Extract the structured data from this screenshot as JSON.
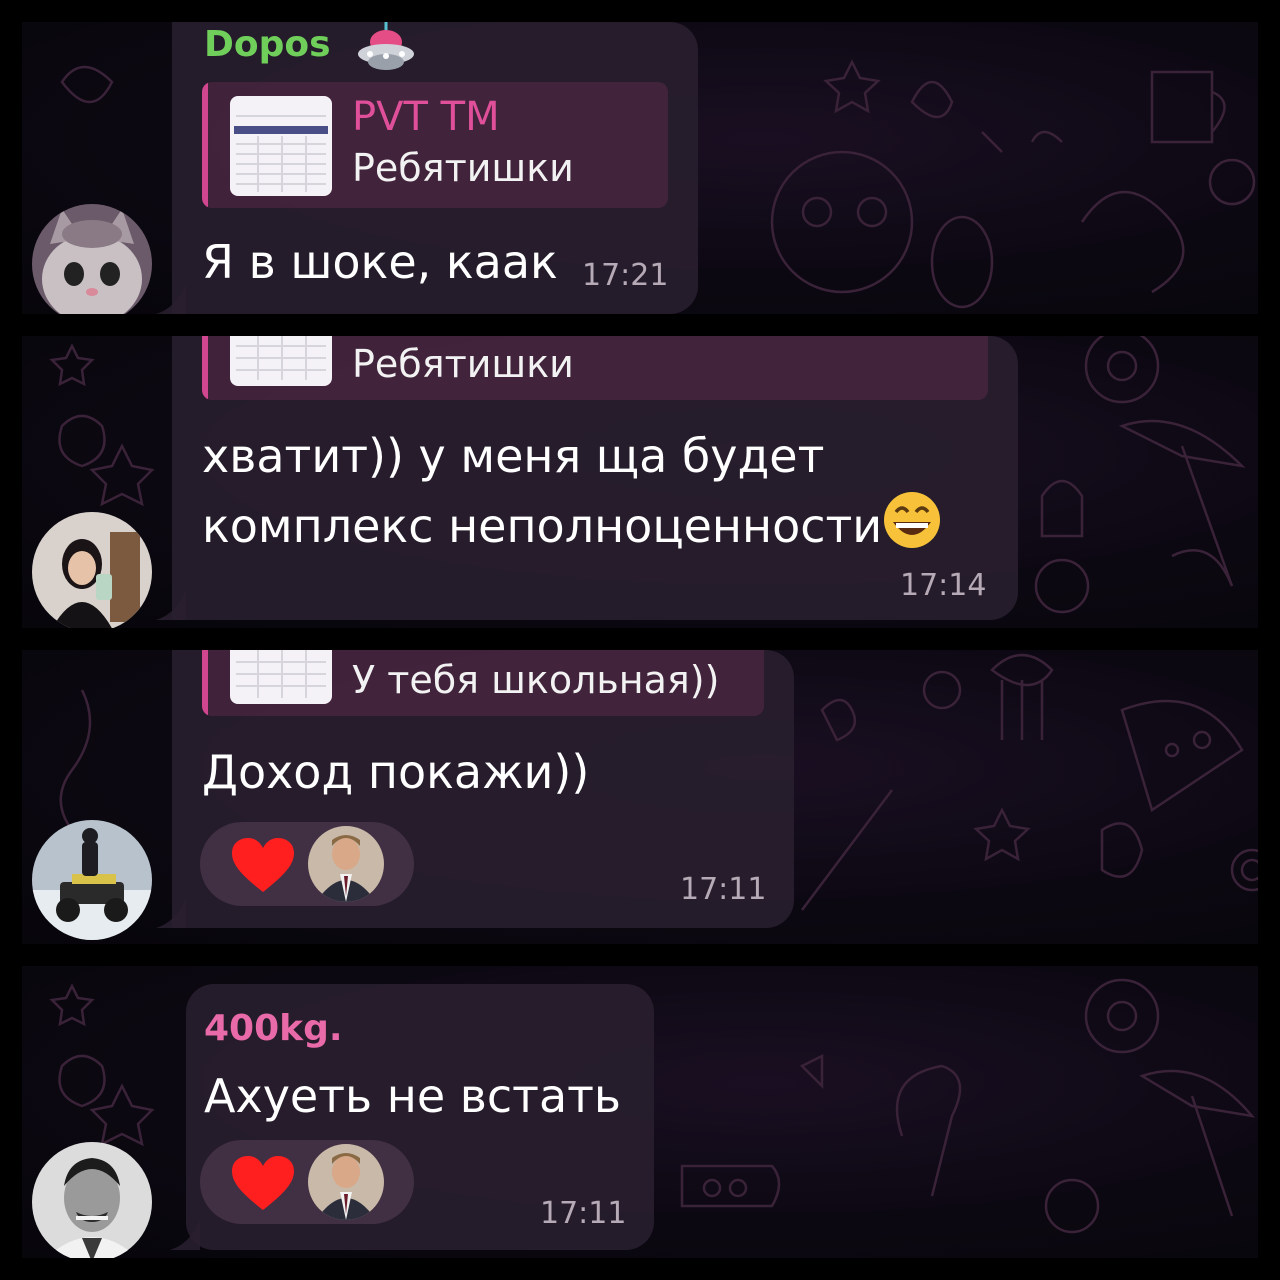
{
  "panels": [
    {
      "sender": {
        "name": "Dopos",
        "color": "#6fcf5a",
        "badge_icon": "ufo-icon"
      },
      "reply": {
        "title": "PVT TM",
        "text": "Ребятишки",
        "thumb_icon": "table-document-thumbnail"
      },
      "message": "Я в шоке, каак",
      "time": "17:21",
      "avatar_icon": "kitten-avatar"
    },
    {
      "reply": {
        "text": "Ребятишки",
        "thumb_icon": "table-document-thumbnail"
      },
      "message_lines": [
        "хватит)) у меня ща будет",
        "комплекс неполноценности"
      ],
      "emoji_icon": "grinning-face-icon",
      "time": "17:14",
      "avatar_icon": "woman-selfie-avatar"
    },
    {
      "reply": {
        "text": "У тебя школьная))",
        "thumb_icon": "table-document-thumbnail"
      },
      "message": "Доход покажи))",
      "reactions": {
        "emoji_icon": "red-heart-icon",
        "reactor_icon": "man-in-suit-avatar"
      },
      "time": "17:11",
      "avatar_icon": "atv-rider-avatar"
    },
    {
      "sender": {
        "name": "400kg.",
        "color": "#e86aa8"
      },
      "message": "Ахуеть не встать",
      "reactions": {
        "emoji_icon": "red-heart-icon",
        "reactor_icon": "man-in-suit-avatar"
      },
      "time": "17:11",
      "avatar_icon": "man-bw-portrait-avatar"
    }
  ],
  "colors": {
    "bubble": "#281e2e",
    "reply_accent": "#d0468f",
    "time": "#b6aab6",
    "background": "#000000"
  }
}
